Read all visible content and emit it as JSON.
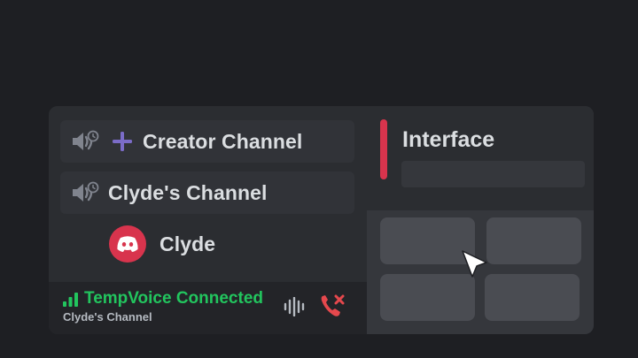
{
  "channels": [
    {
      "label": "Creator Channel",
      "icon": "speaker-clock-icon",
      "extra_icon": "plus-icon"
    },
    {
      "label": "Clyde's Channel",
      "icon": "speaker-clock-icon"
    }
  ],
  "member": {
    "name": "Clyde",
    "avatar_icon": "discord-logo-icon",
    "avatar_color": "#d8344d"
  },
  "voice_status": {
    "title": "TempVoice Connected",
    "channel": "Clyde's Channel",
    "status_color": "#22c55e",
    "icons": [
      "signal-icon",
      "soundwave-icon",
      "hangup-icon"
    ]
  },
  "interface_panel": {
    "title": "Interface",
    "accent_color": "#d8344d"
  },
  "colors": {
    "background": "#1e1f23",
    "card": "#2b2d31",
    "danger": "#e5484d",
    "plus": "#7b6cc8"
  }
}
